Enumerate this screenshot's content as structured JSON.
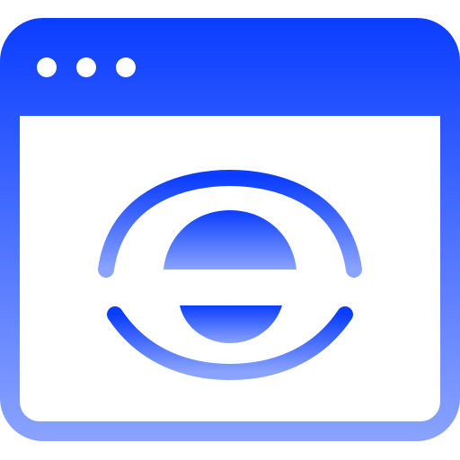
{
  "icon": {
    "name": "browser-window-eye-icon",
    "colors": {
      "top": "#0a3dff",
      "bottom": "#8aa3ff",
      "background": "#ffffff"
    },
    "titlebar_dots": 3
  }
}
